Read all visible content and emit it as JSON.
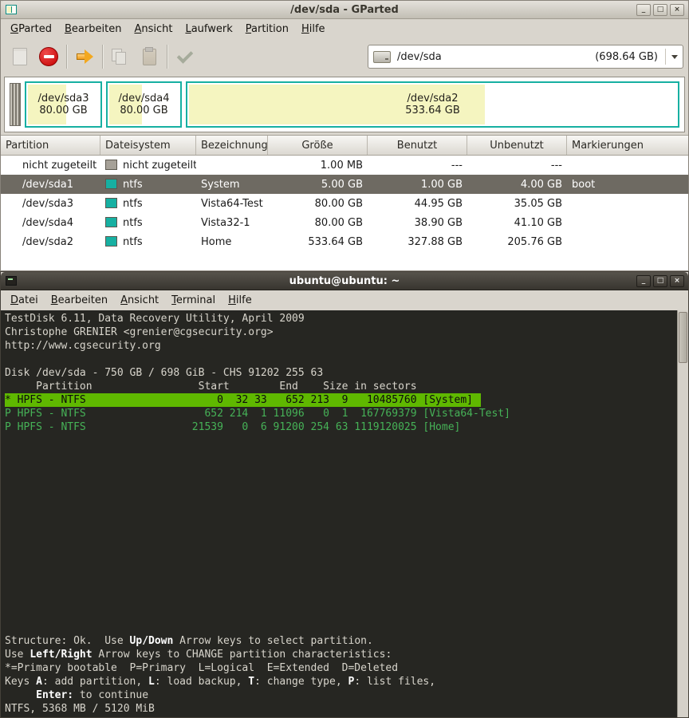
{
  "window_controls": [
    {
      "name": "minimize",
      "glyph": "_"
    },
    {
      "name": "maximize",
      "glyph": "□"
    },
    {
      "name": "close",
      "glyph": "×"
    }
  ],
  "colors": {
    "ntfs": "#17b0a2",
    "unallocated": "#a6a198",
    "used_fill": "#f5f5c0",
    "selected_row": "#6e6a62",
    "terminal_green": "#46b257",
    "terminal_highlight": "#5fb800"
  },
  "gparted": {
    "title": "/dev/sda - GParted",
    "menu": [
      "GParted",
      "Bearbeiten",
      "Ansicht",
      "Laufwerk",
      "Partition",
      "Hilfe"
    ],
    "toolbar": {
      "items": [
        {
          "name": "new-partition-icon",
          "enabled": false
        },
        {
          "name": "delete-partition-icon",
          "enabled": true
        },
        "sep",
        {
          "name": "resize-move-icon",
          "enabled": true
        },
        "sep",
        {
          "name": "copy-icon",
          "enabled": false
        },
        {
          "name": "paste-icon",
          "enabled": false
        },
        "sep",
        {
          "name": "apply-icon",
          "enabled": false
        }
      ],
      "device": "/dev/sda",
      "device_size": "(698.64 GB)"
    },
    "visual": {
      "segments": [
        {
          "type": "unallocated",
          "name": "unallocated-strip",
          "width": 14,
          "line1": "",
          "line2": "",
          "used_pct": 0
        },
        {
          "type": "ntfs",
          "name": "dev-sda3",
          "width": 97,
          "line1": "/dev/sda3",
          "line2": "80.00 GB",
          "used_pct": 56
        },
        {
          "type": "ntfs",
          "name": "dev-sda4",
          "width": 95,
          "line1": "/dev/sda4",
          "line2": "80.00 GB",
          "used_pct": 49
        },
        {
          "type": "ntfs",
          "name": "dev-sda2",
          "width": null,
          "line1": "/dev/sda2",
          "line2": "533.64 GB",
          "used_pct": 61
        }
      ]
    },
    "table": {
      "headers": [
        "Partition",
        "Dateisystem",
        "Bezeichnung",
        "Größe",
        "Benutzt",
        "Unbenutzt",
        "Markierungen"
      ],
      "rows": [
        {
          "partition": "nicht zugeteilt",
          "fs": "nicht zugeteilt",
          "fs_type": "unallocated",
          "label": "",
          "size": "1.00 MB",
          "used": "---",
          "unused": "---",
          "flags": "",
          "selected": false
        },
        {
          "partition": "/dev/sda1",
          "fs": "ntfs",
          "fs_type": "ntfs",
          "label": "System",
          "size": "5.00 GB",
          "used": "1.00 GB",
          "unused": "4.00 GB",
          "flags": "boot",
          "selected": true
        },
        {
          "partition": "/dev/sda3",
          "fs": "ntfs",
          "fs_type": "ntfs",
          "label": "Vista64-Test",
          "size": "80.00 GB",
          "used": "44.95 GB",
          "unused": "35.05 GB",
          "flags": "",
          "selected": false
        },
        {
          "partition": "/dev/sda4",
          "fs": "ntfs",
          "fs_type": "ntfs",
          "label": "Vista32-1",
          "size": "80.00 GB",
          "used": "38.90 GB",
          "unused": "41.10 GB",
          "flags": "",
          "selected": false
        },
        {
          "partition": "/dev/sda2",
          "fs": "ntfs",
          "fs_type": "ntfs",
          "label": "Home",
          "size": "533.64 GB",
          "used": "327.88 GB",
          "unused": "205.76 GB",
          "flags": "",
          "selected": false
        }
      ]
    }
  },
  "terminal": {
    "title": "ubuntu@ubuntu: ~",
    "menu": [
      "Datei",
      "Bearbeiten",
      "Ansicht",
      "Terminal",
      "Hilfe"
    ],
    "top_lines": [
      {
        "seg": [
          {
            "t": "TestDisk 6.11, Data Recovery Utility, April 2009"
          }
        ]
      },
      {
        "seg": [
          {
            "t": "Christophe GRENIER <grenier@cgsecurity.org>"
          }
        ]
      },
      {
        "seg": [
          {
            "t": "http://www.cgsecurity.org"
          }
        ]
      },
      {
        "seg": [
          {
            "t": ""
          }
        ]
      },
      {
        "seg": [
          {
            "t": "Disk /dev/sda - 750 GB / 698 GiB - CHS 91202 255 63"
          }
        ]
      },
      {
        "seg": [
          {
            "t": "     Partition                 Start        End    Size in sectors"
          }
        ]
      },
      {
        "hl": true,
        "seg": [
          {
            "t": "* HPFS - NTFS                     0  32 33   652 213  9   10485760 [System]"
          }
        ]
      },
      {
        "cls": "green",
        "seg": [
          {
            "t": "P HPFS - NTFS                   652 214  1 11096   0  1  167769379 [Vista64-Test]"
          }
        ]
      },
      {
        "cls": "green",
        "seg": [
          {
            "t": "P HPFS - NTFS                 21539   0  6 91200 254 63 1119120025 [Home]"
          }
        ]
      }
    ],
    "bottom_lines": [
      {
        "seg": [
          {
            "t": "Structure: Ok.  Use "
          },
          {
            "t": "Up/Down",
            "b": true
          },
          {
            "t": " Arrow keys to select partition."
          }
        ]
      },
      {
        "seg": [
          {
            "t": "Use "
          },
          {
            "t": "Left/Right",
            "b": true
          },
          {
            "t": " Arrow keys to CHANGE partition characteristics:"
          }
        ]
      },
      {
        "seg": [
          {
            "t": "*=Primary bootable  P=Primary  L=Logical  E=Extended  D=Deleted"
          }
        ]
      },
      {
        "seg": [
          {
            "t": "Keys "
          },
          {
            "t": "A",
            "b": true
          },
          {
            "t": ": add partition, "
          },
          {
            "t": "L",
            "b": true
          },
          {
            "t": ": load backup, "
          },
          {
            "t": "T",
            "b": true
          },
          {
            "t": ": change type, "
          },
          {
            "t": "P",
            "b": true
          },
          {
            "t": ": list files,"
          }
        ]
      },
      {
        "seg": [
          {
            "t": "     "
          },
          {
            "t": "Enter:",
            "b": true
          },
          {
            "t": " to continue"
          }
        ]
      },
      {
        "seg": [
          {
            "t": "NTFS, 5368 MB / 5120 MiB"
          }
        ]
      }
    ]
  }
}
